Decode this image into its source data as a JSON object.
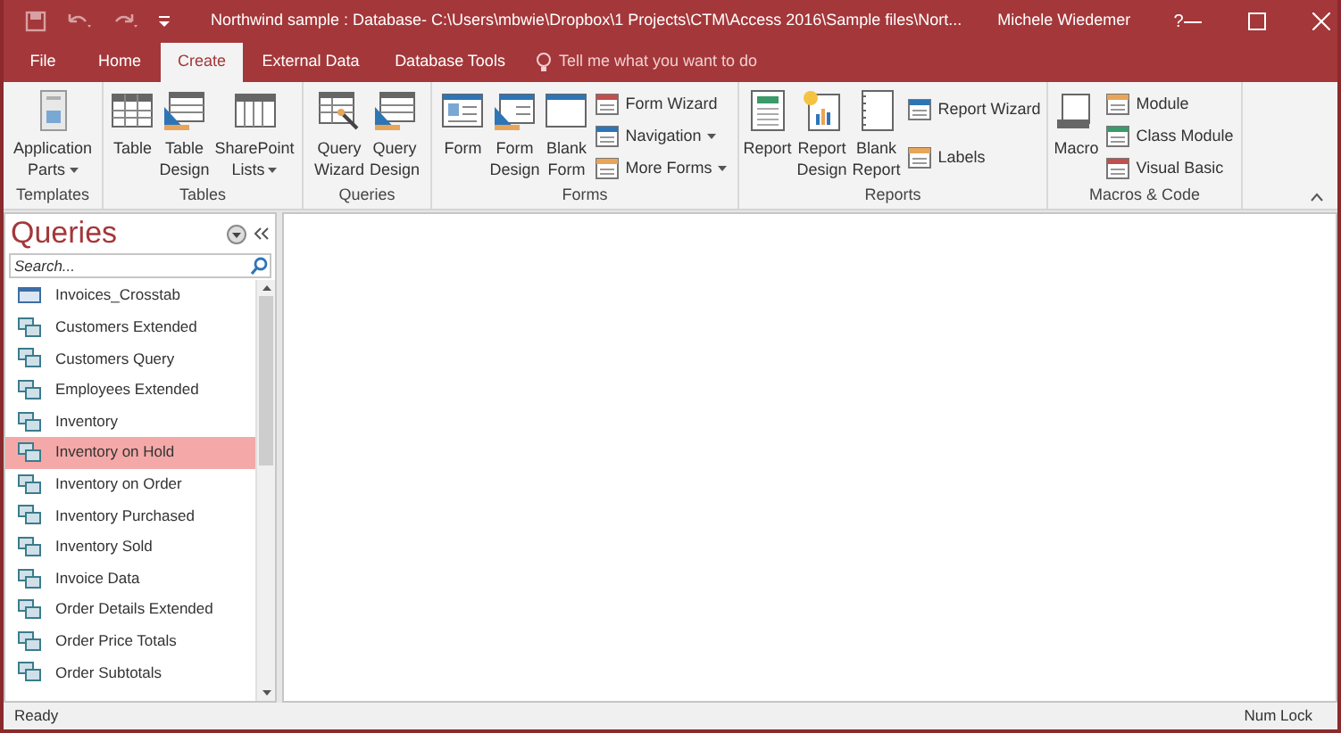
{
  "window": {
    "title": "Northwind sample : Database- C:\\Users\\mbwie\\Dropbox\\1 Projects\\CTM\\Access 2016\\Sample files\\Nort...",
    "user": "Michele Wiedemer",
    "help": "?"
  },
  "tabs": [
    {
      "label": "File",
      "selected": false
    },
    {
      "label": "Home",
      "selected": false
    },
    {
      "label": "Create",
      "selected": true
    },
    {
      "label": "External Data",
      "selected": false
    },
    {
      "label": "Database Tools",
      "selected": false
    }
  ],
  "tell_me": "Tell me what you want to do",
  "ribbon_groups": [
    {
      "label": "Templates",
      "items": [
        {
          "kind": "large",
          "lines": [
            "Application",
            "Parts"
          ],
          "has_menu": true
        }
      ]
    },
    {
      "label": "Tables",
      "items": [
        {
          "kind": "large",
          "lines": [
            "Table"
          ],
          "has_menu": false
        },
        {
          "kind": "large",
          "lines": [
            "Table",
            "Design"
          ],
          "has_menu": false
        },
        {
          "kind": "large",
          "lines": [
            "SharePoint",
            "Lists"
          ],
          "has_menu": true
        }
      ]
    },
    {
      "label": "Queries",
      "items": [
        {
          "kind": "large",
          "lines": [
            "Query",
            "Wizard"
          ],
          "has_menu": false
        },
        {
          "kind": "large",
          "lines": [
            "Query",
            "Design"
          ],
          "has_menu": false
        }
      ]
    },
    {
      "label": "Forms",
      "items": [
        {
          "kind": "large",
          "lines": [
            "Form"
          ],
          "has_menu": false
        },
        {
          "kind": "large",
          "lines": [
            "Form",
            "Design"
          ],
          "has_menu": false
        },
        {
          "kind": "large",
          "lines": [
            "Blank",
            "Form"
          ],
          "has_menu": false
        },
        {
          "kind": "small",
          "entries": [
            {
              "label": "Form Wizard",
              "has_menu": false
            },
            {
              "label": "Navigation",
              "has_menu": true
            },
            {
              "label": "More Forms",
              "has_menu": true
            }
          ]
        }
      ]
    },
    {
      "label": "Reports",
      "items": [
        {
          "kind": "large",
          "lines": [
            "Report"
          ],
          "has_menu": false
        },
        {
          "kind": "large",
          "lines": [
            "Report",
            "Design"
          ],
          "has_menu": false
        },
        {
          "kind": "large",
          "lines": [
            "Blank",
            "Report"
          ],
          "has_menu": false
        },
        {
          "kind": "small",
          "entries": [
            {
              "label": "Report Wizard",
              "has_menu": false
            },
            {
              "label": "Labels",
              "has_menu": false
            }
          ]
        }
      ]
    },
    {
      "label": "Macros & Code",
      "items": [
        {
          "kind": "large",
          "lines": [
            "Macro"
          ],
          "has_menu": false
        },
        {
          "kind": "small",
          "entries": [
            {
              "label": "Module",
              "has_menu": false
            },
            {
              "label": "Class Module",
              "has_menu": false
            },
            {
              "label": "Visual Basic",
              "has_menu": false
            }
          ]
        }
      ]
    }
  ],
  "nav_pane": {
    "title": "Queries",
    "search": {
      "placeholder": "Search..."
    },
    "items": [
      {
        "label": "Invoices_Crosstab",
        "kind": "crosstab",
        "selected": false
      },
      {
        "label": "Customers Extended",
        "kind": "select",
        "selected": false
      },
      {
        "label": "Customers Query",
        "kind": "select",
        "selected": false
      },
      {
        "label": "Employees Extended",
        "kind": "select",
        "selected": false
      },
      {
        "label": "Inventory",
        "kind": "select",
        "selected": false
      },
      {
        "label": "Inventory on Hold",
        "kind": "select",
        "selected": true
      },
      {
        "label": "Inventory on Order",
        "kind": "select",
        "selected": false
      },
      {
        "label": "Inventory Purchased",
        "kind": "select",
        "selected": false
      },
      {
        "label": "Inventory Sold",
        "kind": "select",
        "selected": false
      },
      {
        "label": "Invoice Data",
        "kind": "select",
        "selected": false
      },
      {
        "label": "Order Details Extended",
        "kind": "select",
        "selected": false
      },
      {
        "label": "Order Price Totals",
        "kind": "select",
        "selected": false
      },
      {
        "label": "Order Subtotals",
        "kind": "select",
        "selected": false
      }
    ]
  },
  "status_bar": {
    "left": "Ready",
    "right": "Num Lock"
  }
}
